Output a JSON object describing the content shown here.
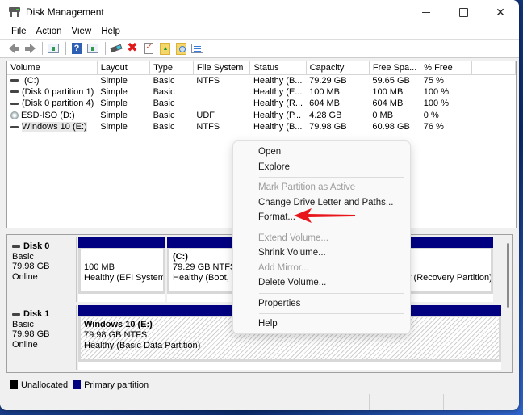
{
  "window": {
    "title": "Disk Management",
    "controls": {
      "minimize": "minimize",
      "maximize": "maximize",
      "close": "✕"
    }
  },
  "menubar": [
    "File",
    "Action",
    "View",
    "Help"
  ],
  "toolbar": {
    "icons": [
      "back-arrow-icon",
      "forward-arrow-icon",
      "show-hide-console-tree-icon",
      "help-icon",
      "show-hide-action-pane-icon",
      "connect-virtual-disk-icon",
      "delete-icon",
      "checklist-icon",
      "folder-up-icon",
      "folder-search-icon",
      "properties-list-icon"
    ]
  },
  "volume_list": {
    "columns": [
      "Volume",
      "Layout",
      "Type",
      "File System",
      "Status",
      "Capacity",
      "Free Spa...",
      "% Free"
    ],
    "rows": [
      {
        "icon": "disk",
        "volume": " (C:)",
        "layout": "Simple",
        "type": "Basic",
        "fs": "NTFS",
        "status": "Healthy (B...",
        "capacity": "79.29 GB",
        "free": "59.65 GB",
        "pct": "75 %"
      },
      {
        "icon": "disk",
        "volume": "(Disk 0 partition 1)",
        "layout": "Simple",
        "type": "Basic",
        "fs": "",
        "status": "Healthy (E...",
        "capacity": "100 MB",
        "free": "100 MB",
        "pct": "100 %"
      },
      {
        "icon": "disk",
        "volume": "(Disk 0 partition 4)",
        "layout": "Simple",
        "type": "Basic",
        "fs": "",
        "status": "Healthy (R...",
        "capacity": "604 MB",
        "free": "604 MB",
        "pct": "100 %"
      },
      {
        "icon": "cd",
        "volume": "ESD-ISO (D:)",
        "layout": "Simple",
        "type": "Basic",
        "fs": "UDF",
        "status": "Healthy (P...",
        "capacity": "4.28 GB",
        "free": "0 MB",
        "pct": "0 %"
      },
      {
        "icon": "disk",
        "volume": "Windows 10 (E:)",
        "layout": "Simple",
        "type": "Basic",
        "fs": "NTFS",
        "status": "Healthy (B...",
        "capacity": "79.98 GB",
        "free": "60.98 GB",
        "pct": "76 %"
      }
    ]
  },
  "disks": [
    {
      "name": "Disk 0",
      "type": "Basic",
      "size": "79.98 GB",
      "state": "Online",
      "partitions": [
        {
          "name": "",
          "size": "100 MB",
          "status": "Healthy (EFI System P"
        },
        {
          "name": "(C:)",
          "size": "79.29 GB NTFS",
          "status": "Healthy (Boot, Pa"
        },
        {
          "name": "",
          "size": "",
          "status": "y (Recovery Partition)"
        }
      ]
    },
    {
      "name": "Disk 1",
      "type": "Basic",
      "size": "79.98 GB",
      "state": "Online",
      "partitions": [
        {
          "name": "Windows 10  (E:)",
          "size": "79.98 GB NTFS",
          "status": "Healthy (Basic Data Partition)"
        }
      ]
    }
  ],
  "legend": [
    {
      "label": "Unallocated",
      "color": "#000000"
    },
    {
      "label": "Primary partition",
      "color": "#000080"
    }
  ],
  "context_menu": {
    "items": [
      {
        "label": "Open",
        "enabled": true
      },
      {
        "label": "Explore",
        "enabled": true
      },
      {
        "label": "Mark Partition as Active",
        "enabled": false
      },
      {
        "label": "Change Drive Letter and Paths...",
        "enabled": true
      },
      {
        "label": "Format...",
        "enabled": true
      },
      {
        "label": "Extend Volume...",
        "enabled": false
      },
      {
        "label": "Shrink Volume...",
        "enabled": true
      },
      {
        "label": "Add Mirror...",
        "enabled": false
      },
      {
        "label": "Delete Volume...",
        "enabled": true
      },
      {
        "label": "Properties",
        "enabled": true
      },
      {
        "label": "Help",
        "enabled": true
      }
    ]
  },
  "colors": {
    "primary_partition": "#000080",
    "annotation_arrow": "#e8161b"
  }
}
